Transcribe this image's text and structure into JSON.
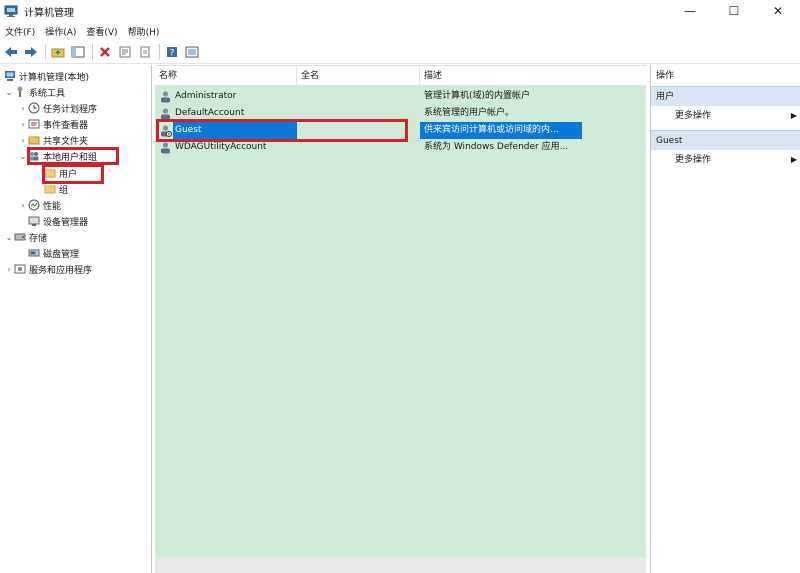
{
  "window": {
    "title": "计算机管理",
    "minimize": "—",
    "maximize": "☐",
    "close": "✕"
  },
  "menu": [
    "文件(F)",
    "操作(A)",
    "查看(V)",
    "帮助(H)"
  ],
  "toolbar": {
    "icons": [
      "back-arrow-icon",
      "forward-arrow-icon",
      "folder-up-icon",
      "show-hide-tree-icon",
      "delete-icon",
      "properties-icon",
      "export-icon",
      "help-icon",
      "console-icon"
    ]
  },
  "tree": {
    "root": "计算机管理(本地)",
    "system_tools": "系统工具",
    "task_scheduler": "任务计划程序",
    "event_viewer": "事件查看器",
    "shared_folders": "共享文件夹",
    "local_users_groups": "本地用户和组",
    "users": "用户",
    "groups": "组",
    "performance": "性能",
    "device_manager": "设备管理器",
    "storage": "存储",
    "disk_management": "磁盘管理",
    "services_apps": "服务和应用程序"
  },
  "list": {
    "columns": [
      "名称",
      "全名",
      "描述"
    ],
    "rows": [
      {
        "name": "Administrator",
        "fullname": "",
        "description": "管理计算机(域)的内置帐户"
      },
      {
        "name": "DefaultAccount",
        "fullname": "",
        "description": "系统管理的用户帐户。"
      },
      {
        "name": "Guest",
        "fullname": "",
        "description": "供来宾访问计算机或访问域的内..."
      },
      {
        "name": "WDAGUtilityAccount",
        "fullname": "",
        "description": "系统为 Windows Defender 应用..."
      }
    ],
    "selected_index": 2
  },
  "actions": {
    "header": "操作",
    "section1": "用户",
    "more1": "更多操作",
    "section2": "Guest",
    "more2": "更多操作"
  },
  "colors": {
    "list_bg": "#cfead6",
    "selection": "#0a78d7",
    "highlight_box": "#d2212d",
    "action_section": "#d8e6f3"
  }
}
